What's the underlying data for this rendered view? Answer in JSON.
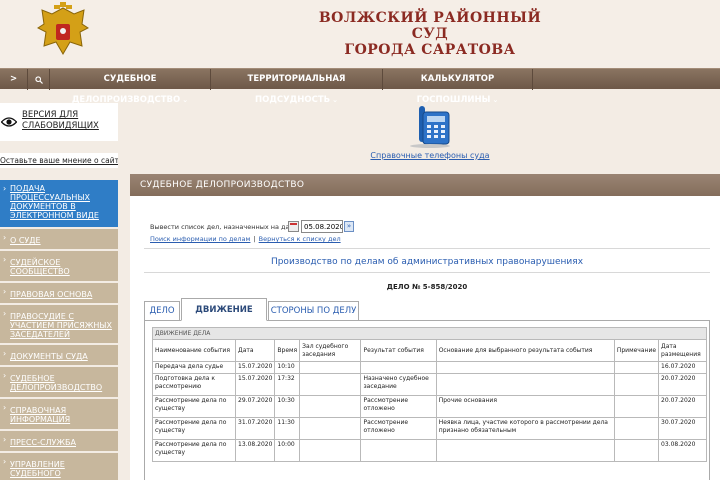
{
  "header": {
    "court_line1": "ВОЛЖСКИЙ РАЙОННЫЙ СУД",
    "court_line2": "ГОРОДА САРАТОВА"
  },
  "nav": {
    "items": [
      {
        "label": ">",
        "icon": "arrow"
      },
      {
        "label": "",
        "icon": "search-icon"
      },
      {
        "label": "СУДЕБНОЕ ДЕЛОПРОИЗВОДСТВО"
      },
      {
        "label": "ТЕРРИТОРИАЛЬНАЯ ПОДСУДНОСТЬ"
      },
      {
        "label": "КАЛЬКУЛЯТОР ГОСПОШЛИНЫ"
      }
    ]
  },
  "sidebar": {
    "vision_label": "ВЕРСИЯ ДЛЯ СЛАБОВИДЯЩИХ",
    "feedback_label": "Оставьте ваше мнение о сайте",
    "menu": [
      "ПОДАЧА ПРОЦЕССУАЛЬНЫХ ДОКУМЕНТОВ В ЭЛЕКТРОННОМ ВИДЕ",
      "О СУДЕ",
      "СУДЕЙСКОЕ СООБЩЕСТВО",
      "ПРАВОВАЯ ОСНОВА",
      "ПРАВОСУДИЕ С УЧАСТИЕМ ПРИСЯЖНЫХ ЗАСЕДАТЕЛЕЙ",
      "ДОКУМЕНТЫ СУДА",
      "СУДЕБНОЕ ДЕЛОПРОИЗВОДСТВО",
      "СПРАВОЧНАЯ ИНФОРМАЦИЯ",
      "ПРЕСС-СЛУЖБА",
      "УПРАВЛЕНИЕ СУДЕБНОГО"
    ]
  },
  "phone": {
    "link_label": "Справочные телефоны суда"
  },
  "main": {
    "panel_title": "СУДЕБНОЕ ДЕЛОПРОИЗВОДСТВО",
    "date_prompt": "Вывести список дел, назначенных на дату",
    "date_value": "05.08.2020",
    "go_glyph": "»",
    "link_search": "Поиск информации по делам",
    "link_separator": "|",
    "link_back": "Вернуться к списку дел",
    "section_title": "Производство по делам об административных правонарушениях",
    "case_number": "ДЕЛО № 5-858/2020",
    "tabs": [
      "ДЕЛО",
      "ДВИЖЕНИЕ ДЕЛА",
      "СТОРОНЫ ПО ДЕЛУ"
    ],
    "active_tab": "ДВИЖЕНИЕ ДЕЛА"
  },
  "events_table": {
    "caption": "ДВИЖЕНИЕ ДЕЛА",
    "columns": [
      "Наименование события",
      "Дата",
      "Время",
      "Зал судебного заседания",
      "Результат события",
      "Основание для выбранного результата события",
      "Примечание",
      "Дата размещения"
    ],
    "rows": [
      [
        "Передача дела судье",
        "15.07.2020",
        "10:10",
        "",
        "",
        "",
        "",
        "16.07.2020"
      ],
      [
        "Подготовка дела к рассмотрению",
        "15.07.2020",
        "17:32",
        "",
        "Назначено судебное заседание",
        "",
        "",
        "20.07.2020"
      ],
      [
        "Рассмотрение дела по существу",
        "29.07.2020",
        "10:30",
        "",
        "Рассмотрение отложено",
        "Прочие основания",
        "",
        "20.07.2020"
      ],
      [
        "Рассмотрение дела по существу",
        "31.07.2020",
        "11:30",
        "",
        "Рассмотрение отложено",
        "Неявка лица, участие которого в рассмотрении дела признано обязательным",
        "",
        "30.07.2020"
      ],
      [
        "Рассмотрение дела по существу",
        "13.08.2020",
        "10:00",
        "",
        "",
        "",
        "",
        "03.08.2020"
      ]
    ]
  }
}
